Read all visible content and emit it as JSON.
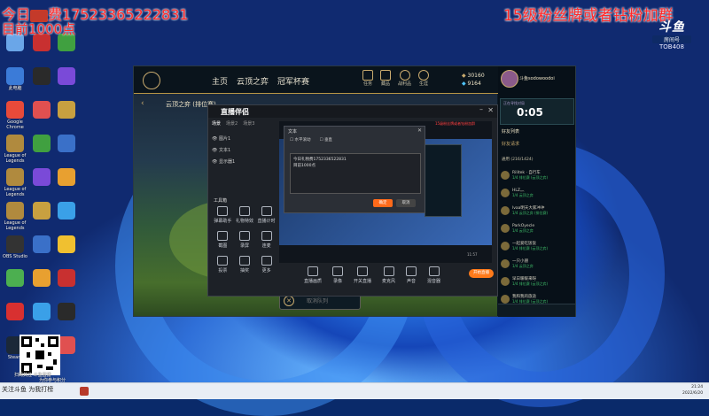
{
  "overlay": {
    "top_left_line1": "今日",
    "top_left_line1b": "费175233652228",
    "top_left_line1c": "31",
    "top_left_line2": "目前1000点",
    "top_right": "15级粉丝牌或者钻粉加群",
    "watermark_logo": "斗鱼",
    "watermark_sub": "房间号",
    "watermark_id": "TOB408"
  },
  "desktop_icons": [
    {
      "label": "",
      "color": "#6aa6e8"
    },
    {
      "label": "此电脑",
      "color": "#3b7bd8"
    },
    {
      "label": "Google Chrome",
      "color": "#e84a3a"
    },
    {
      "label": "League of Legends",
      "color": "#b08a3e"
    },
    {
      "label": "League of Legends",
      "color": "#b08a3e"
    },
    {
      "label": "League of Legends",
      "color": "#b08a3e"
    },
    {
      "label": "OBS Studio",
      "color": "#333333"
    },
    {
      "label": "",
      "color": "#4caf50"
    },
    {
      "label": "",
      "color": "#d83030"
    },
    {
      "label": "Steam",
      "color": "#1b2838"
    }
  ],
  "client": {
    "nav": [
      "主页",
      "云顶之弈",
      "冠军杯赛"
    ],
    "chips": [
      "任务",
      "藏品",
      "战利品",
      "生涯"
    ],
    "currency_rp": "30160",
    "currency_be": "9164",
    "username": "斗鱼sodowoodoi",
    "mode_title": "云顶之弈 (排位赛)",
    "timer_label": "正在寻找对局",
    "timer": "0:05",
    "social_header": "好友列表",
    "friend_request": "好友请求",
    "group": "通用 (216/1424)",
    "friends": [
      {
        "name": "Rilitek · 自行车",
        "status": "1/4 排位赛 (云顶之弈)"
      },
      {
        "name": "HLZ灬",
        "status": "1/4 云顶之弈"
      },
      {
        "name": "lvaa明天大家冲冲",
        "status": "1/4 云顶之弈 (排位赛)"
      },
      {
        "name": "ParkOyecle",
        "status": "1/4 云顶之弈"
      },
      {
        "name": "一起爱吃饭饭",
        "status": "1/4 排位赛 (云顶之弈)"
      },
      {
        "name": "一只小朋",
        "status": "1/4 云顶之弈"
      },
      {
        "name": "早日暖暖来呀",
        "status": "1/4 排位赛 (云顶之弈)"
      },
      {
        "name": "我和我的旅途",
        "status": "1/4 排位赛 (云顶之弈)"
      }
    ],
    "find_match": "取消队列"
  },
  "streamer": {
    "logo": "直播伴侣",
    "scene_tabs": [
      "场景",
      "场景2",
      "场景3"
    ],
    "sources": [
      "图片1",
      "文本1",
      "显示器1"
    ],
    "tools_header": "工具箱",
    "tools": [
      "弹幕助手",
      "礼物特效",
      "直播计时",
      "截图",
      "录屏",
      "连麦",
      "投票",
      "抽奖",
      "更多"
    ],
    "bottom_tools": [
      "直播画质",
      "录像",
      "开关直播",
      "麦克风",
      "声音",
      "混音器"
    ],
    "start_button": "开始直播",
    "notice": "15级粉丝牌或者钻粉加群",
    "preview_footer": "11:57"
  },
  "dialog": {
    "title": "文本",
    "check1": "水平滚动",
    "check2": "垂直",
    "text_line1": "今日礼物费1752336522831",
    "text_line2": "目前1000点",
    "ok": "确定",
    "cancel": "取消"
  },
  "taskbar": {
    "qr_caption1": "扫码关注 斗鱼直播",
    "qr_caption2": "为你参与积分",
    "left_text": "关注斗鱼 为我打榜",
    "time": "21:24",
    "date": "2022/6/20"
  }
}
